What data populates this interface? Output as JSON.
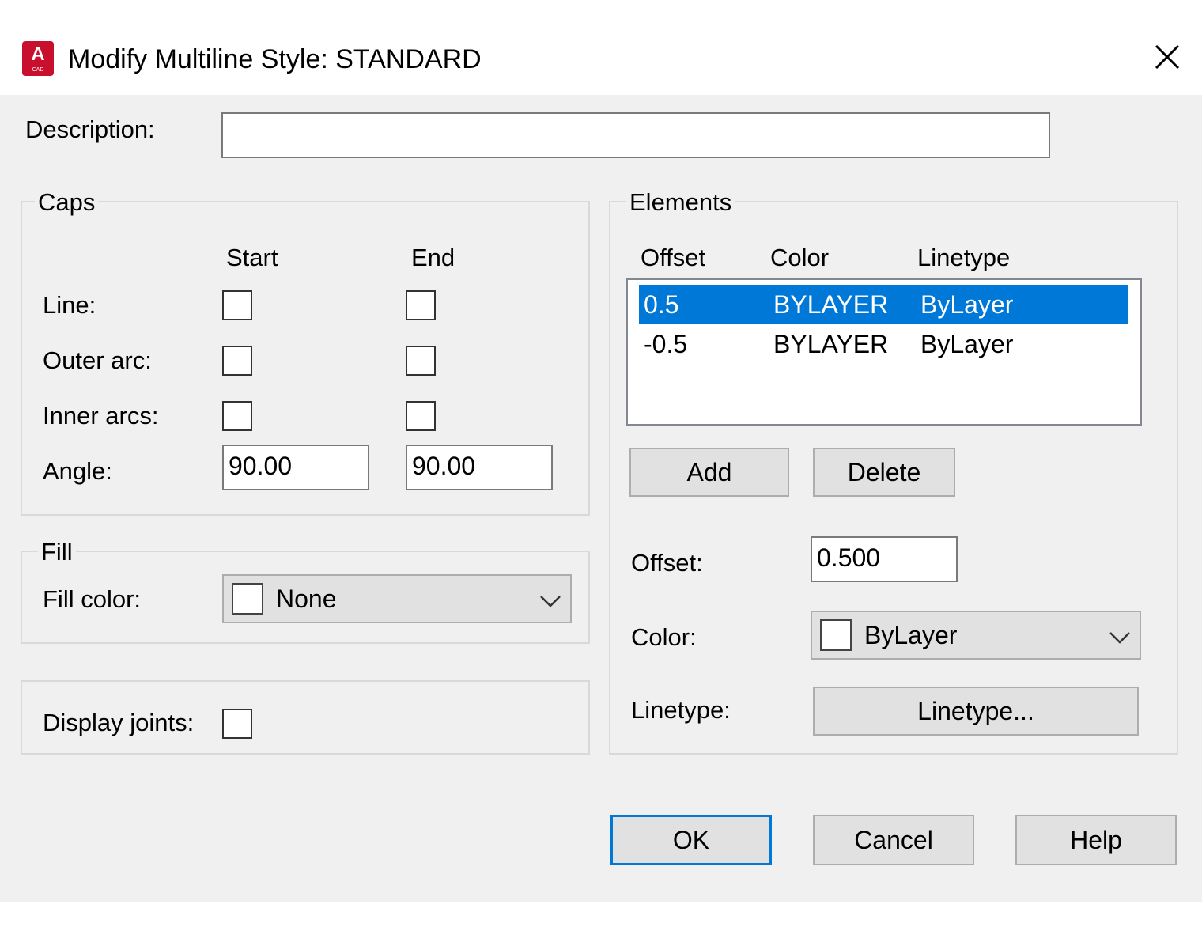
{
  "window": {
    "title": "Modify Multiline Style: STANDARD",
    "app_icon_letter": "A",
    "app_icon_sub": "CAD"
  },
  "description": {
    "label": "Description:",
    "value": ""
  },
  "caps": {
    "title": "Caps",
    "start_header": "Start",
    "end_header": "End",
    "line_label": "Line:",
    "outer_arc_label": "Outer arc:",
    "inner_arcs_label": "Inner arcs:",
    "angle_label": "Angle:",
    "angle_start": "90.00",
    "angle_end": "90.00",
    "checked": {
      "line_start": false,
      "line_end": false,
      "outer_start": false,
      "outer_end": false,
      "inner_start": false,
      "inner_end": false
    }
  },
  "fill": {
    "title": "Fill",
    "color_label": "Fill color:",
    "color_value": "None"
  },
  "joints": {
    "label": "Display joints:",
    "checked": false
  },
  "elements": {
    "title": "Elements",
    "columns": [
      "Offset",
      "Color",
      "Linetype"
    ],
    "rows": [
      {
        "offset": "0.5",
        "color": "BYLAYER",
        "linetype": "ByLayer",
        "selected": true
      },
      {
        "offset": "-0.5",
        "color": "BYLAYER",
        "linetype": "ByLayer",
        "selected": false
      }
    ],
    "add_label": "Add",
    "delete_label": "Delete",
    "offset_label": "Offset:",
    "offset_value": "0.500",
    "color_label": "Color:",
    "color_value": "ByLayer",
    "linetype_label": "Linetype:",
    "linetype_button": "Linetype..."
  },
  "footer": {
    "ok_label": "OK",
    "cancel_label": "Cancel",
    "help_label": "Help"
  },
  "colors": {
    "selection": "#0078d7",
    "dialog_bg": "#f0f0f0",
    "app_icon": "#c8102e"
  },
  "icons": {
    "close": "close-icon",
    "dropdown": "chevron-down-icon",
    "app": "autocad-app-icon"
  }
}
